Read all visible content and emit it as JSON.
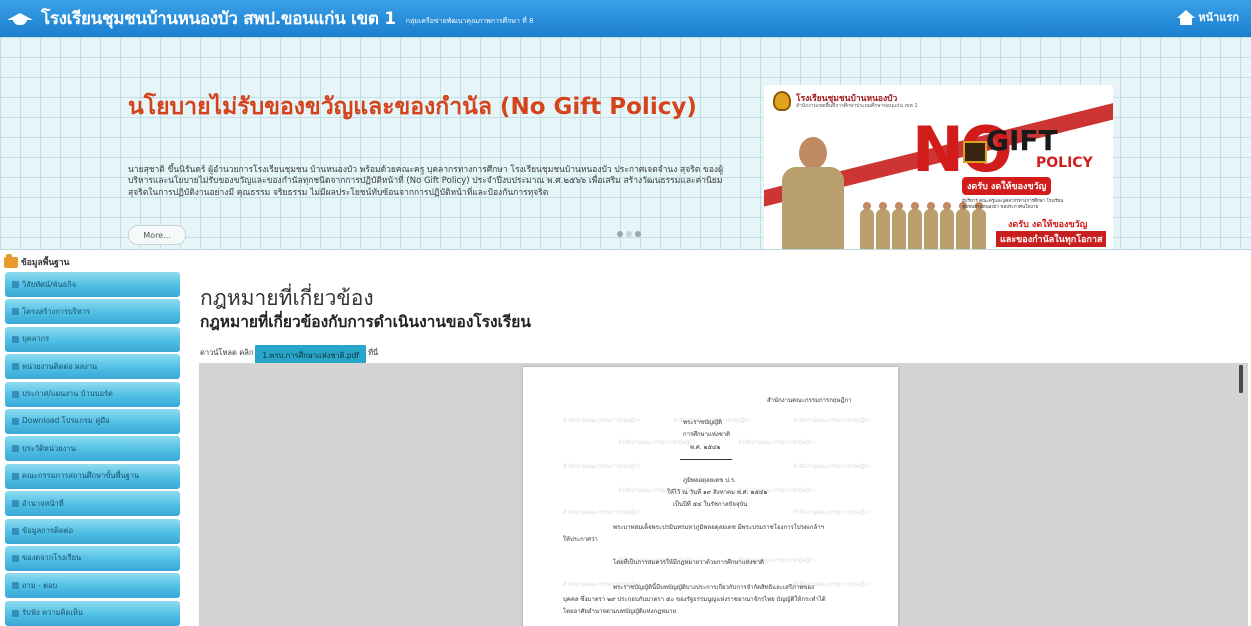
{
  "header": {
    "title": "โรงเรียนชุมชนบ้านหนองบัว สพป.ขอนแก่น เขต 1",
    "subtitle": "กลุ่มเครือข่ายพัฒนาคุณภาพการศึกษา ที่ 8",
    "home_label": "หน้าแรก"
  },
  "banner": {
    "title": "นโยบายไม่รับของขวัญและของกำนัล (No Gift Policy)",
    "text": "นายสุชาติ ขึ้นนิรันดร์ ผู้อำนวยการโรงเรียนชุมชน บ้านหนองบัว พร้อมด้วยคณะครู บุคลากรทางการศึกษา โรงเรียนชุมชนบ้านหนองบัว ประกาศเจตจำนง สุจริต ของผู้บริหารและนโยบายไม่รับของขวัญและของกำนัลทุกชนิดจากการปฏิบัติหน้าที่ (No Gift Policy) ประจำปีงบประมาณ พ.ศ.๒๕๖๖ เพื่อเสริม สร้างวัฒนธรรมและค่านิยมสุจริตในการปฏิบัติงานอย่างมี คุณธรรม จริยธรรม ไม่มีผลประโยชน์ทับซ้อนจากการปฏิบัติหน้าที่และป้องกันการทุจริต",
    "more_label": "More...",
    "poster": {
      "school": "โรงเรียนชุมชนบ้านหนองบัว",
      "school_sub": "สำนักงานเขตพื้นที่การศึกษาประถมศึกษาขอนแก่น เขต 1",
      "no": "NO",
      "gift": "GIFT",
      "policy": "POLICY",
      "tagline": "งดรับ งดให้ของขวัญ",
      "small": "ผู้บริหาร คณะครูและบุคลากรทางการศึกษา โรงเรียนชุมชนบ้านหนองบัว ขอประกาศนโยบาย",
      "slogan1": "งดรับ งดให้ของขวัญ",
      "slogan2": "และของกำนัลในทุกโอกาส"
    }
  },
  "sidebar": {
    "heading": "ข้อมูลพื้นฐาน",
    "items": [
      {
        "label": "วิสัยทัศน์/พันธกิจ"
      },
      {
        "label": "โครงสร้างการบริหาร"
      },
      {
        "label": "บุคลากร"
      },
      {
        "label": "หน่วยงานติดต่อ ผลงาน"
      },
      {
        "label": "ประกาศ/แผนงาน บ้านบอร์ด"
      },
      {
        "label": "Download โปรแกรม คู่มือ"
      },
      {
        "label": "ประวัติหน่วยงาน"
      },
      {
        "label": "คณะกรรมการสถานศึกษาขั้นพื้นฐาน"
      },
      {
        "label": "อำนาจหน้าที่"
      },
      {
        "label": "ข้อมูลการติดต่อ"
      },
      {
        "label": "ของดจากโรงเรียน"
      },
      {
        "label": "ถาม - ตอบ"
      },
      {
        "label": "รับฟัง ความคิดเห็น"
      }
    ]
  },
  "main": {
    "title": "กฎหมายที่เกี่ยวข้อง",
    "subtitle": "กฎหมายที่เกี่ยวข้องกับการดำเนินงานของโรงเรียน",
    "download_prefix": "ดาวน์โหลด คลิก",
    "download_file": "1.พรบ.การศึกษาแห่งชาติ.pdf",
    "download_suffix": "ที่นี่"
  },
  "document": {
    "header_right": "สำนักงานคณะกรรมการกฤษฎีกา",
    "title1": "พระราชบัญญัติ",
    "title2": "การศึกษาแห่งชาติ",
    "title3": "พ.ศ. ๒๕๔๒",
    "king": "ภูมิพลอดุลยเดช ป.ร.",
    "given": "ให้ไว้ ณ วันที่ ๑๙ สิงหาคม พ.ศ. ๒๕๔๒",
    "year": "เป็นปีที่ ๕๔ ในรัชกาลปัจจุบัน",
    "para1a": "พระบาทสมเด็จพระปรมินทรมหาภูมิพลอดุลยเดช มีพระบรมราชโองการโปรดเกล้าฯ",
    "para1b": "ให้ประกาศว่า",
    "para2": "โดยที่เป็นการสมควรให้มีกฎหมายว่าด้วยการศึกษาแห่งชาติ",
    "para3a": "พระราชบัญญัตินี้มีบทบัญญัติบางประการเกี่ยวกับการจำกัดสิทธิและเสรีภาพของ",
    "para3b": "บุคคล ซึ่งมาตรา ๒๙ ประกอบกับมาตรา ๕๐ ของรัฐธรรมนูญแห่งราชอาณาจักรไทย บัญญัติให้กระทำได้",
    "para3c": "โดยอาศัยอำนาจตามบทบัญญัติแห่งกฎหมาย",
    "watermark": "สำนักงานคณะกรรมการกฤษฎีกา"
  },
  "colors": {
    "header_bg": "#1b7fd0",
    "banner_title": "#d5431b",
    "sidebar_item": "#4fbfe3",
    "download_btn": "#29a6c7",
    "poster_red": "#d21c1c"
  }
}
